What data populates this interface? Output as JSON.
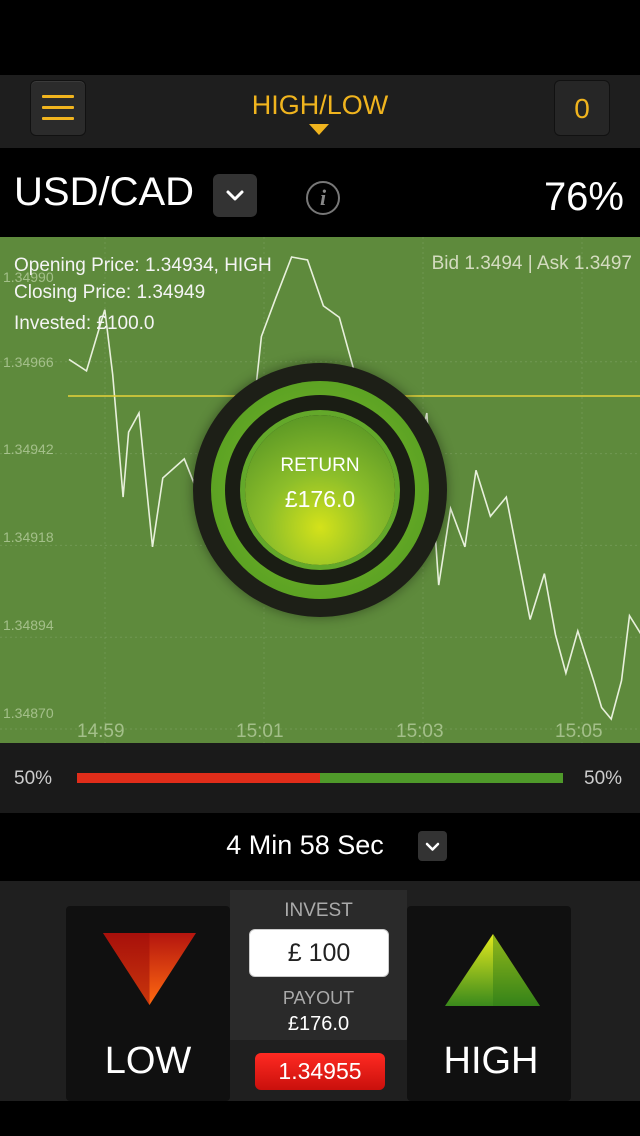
{
  "header": {
    "title": "HIGH/LOW",
    "count": "0",
    "accent": "#f0b41e"
  },
  "asset": {
    "name": "USD/CAD",
    "payout_percent": "76%",
    "info_symbol": "i"
  },
  "chart": {
    "y_labels": [
      "1.34990",
      "1.34966",
      "1.34942",
      "1.34918",
      "1.34894",
      "1.34870"
    ],
    "x_labels": [
      "14:59",
      "15:01",
      "15:03",
      "15:05"
    ],
    "opening_price": "Opening Price: 1.34934, HIGH",
    "closing_price": "Closing Price: 1.34949",
    "invested": "Invested: £100.0",
    "bid_ask": "Bid 1.3494 | Ask 1.3497",
    "background": "#5e8a3c",
    "line_color": "#e8f0dc",
    "strike_color": "#e6d23a"
  },
  "chart_data": {
    "type": "line",
    "ylim": [
      1.3487,
      1.34996
    ],
    "x_ticks": [
      "14:59",
      "15:01",
      "15:03",
      "15:05"
    ],
    "strike_level": 1.34949,
    "series": [
      {
        "values": [
          [
            14.5,
            1.34964
          ],
          [
            14.72,
            1.34961
          ],
          [
            14.95,
            1.34977
          ],
          [
            15.05,
            1.3496
          ],
          [
            15.18,
            1.34928
          ],
          [
            15.25,
            1.34945
          ],
          [
            15.38,
            1.3495
          ],
          [
            15.55,
            1.34915
          ],
          [
            15.68,
            1.34933
          ],
          [
            15.95,
            1.34938
          ],
          [
            16.2,
            1.34925
          ],
          [
            16.45,
            1.34925
          ],
          [
            16.6,
            1.34937
          ],
          [
            16.78,
            1.34943
          ],
          [
            16.92,
            1.3497
          ],
          [
            17.1,
            1.3498
          ],
          [
            17.3,
            1.3501
          ],
          [
            17.5,
            1.3499
          ],
          [
            17.7,
            1.34978
          ],
          [
            17.9,
            1.34975
          ],
          [
            18.1,
            1.3496
          ],
          [
            18.45,
            1.34945
          ],
          [
            18.6,
            1.3491
          ],
          [
            18.75,
            1.34928
          ],
          [
            19.0,
            1.3495
          ],
          [
            19.15,
            1.34905
          ],
          [
            19.3,
            1.34925
          ],
          [
            19.48,
            1.34915
          ],
          [
            19.62,
            1.34935
          ],
          [
            19.8,
            1.34923
          ],
          [
            20.0,
            1.34928
          ],
          [
            20.15,
            1.34912
          ],
          [
            20.3,
            1.34896
          ],
          [
            20.48,
            1.34908
          ],
          [
            20.62,
            1.34892
          ],
          [
            20.75,
            1.34882
          ],
          [
            20.9,
            1.34893
          ],
          [
            21.1,
            1.3488
          ],
          [
            21.2,
            1.34873
          ],
          [
            21.32,
            1.3487
          ],
          [
            21.45,
            1.3488
          ],
          [
            21.55,
            1.34897
          ],
          [
            21.7,
            1.34892
          ],
          [
            21.82,
            1.34902
          ],
          [
            21.95,
            1.3489
          ],
          [
            22.05,
            1.34905
          ],
          [
            22.18,
            1.34913
          ],
          [
            22.3,
            1.34922
          ],
          [
            22.45,
            1.3491
          ],
          [
            22.6,
            1.34935
          ],
          [
            22.78,
            1.34928
          ],
          [
            22.92,
            1.34918
          ],
          [
            23.05,
            1.34911
          ],
          [
            23.2,
            1.34913
          ],
          [
            23.35,
            1.34945
          ],
          [
            23.5,
            1.34948
          ],
          [
            23.65,
            1.34951
          ]
        ]
      }
    ]
  },
  "return_panel": {
    "label": "RETURN",
    "value": "£176.0"
  },
  "sentiment": {
    "low_pct_label": "50%",
    "high_pct_label": "50%",
    "low_fraction": 0.5,
    "low_color": "#e02d1a",
    "high_color": "#4f9a2a"
  },
  "expiry": {
    "text": "4 Min 58 Sec"
  },
  "trade": {
    "low_label": "LOW",
    "high_label": "HIGH",
    "invest_label": "INVEST",
    "invest_value": "£ 100",
    "payout_label": "PAYOUT",
    "payout_value": "£176.0",
    "current_price": "1.34955",
    "low_color": "#e02d1a",
    "high_color": "#7cc01e"
  }
}
